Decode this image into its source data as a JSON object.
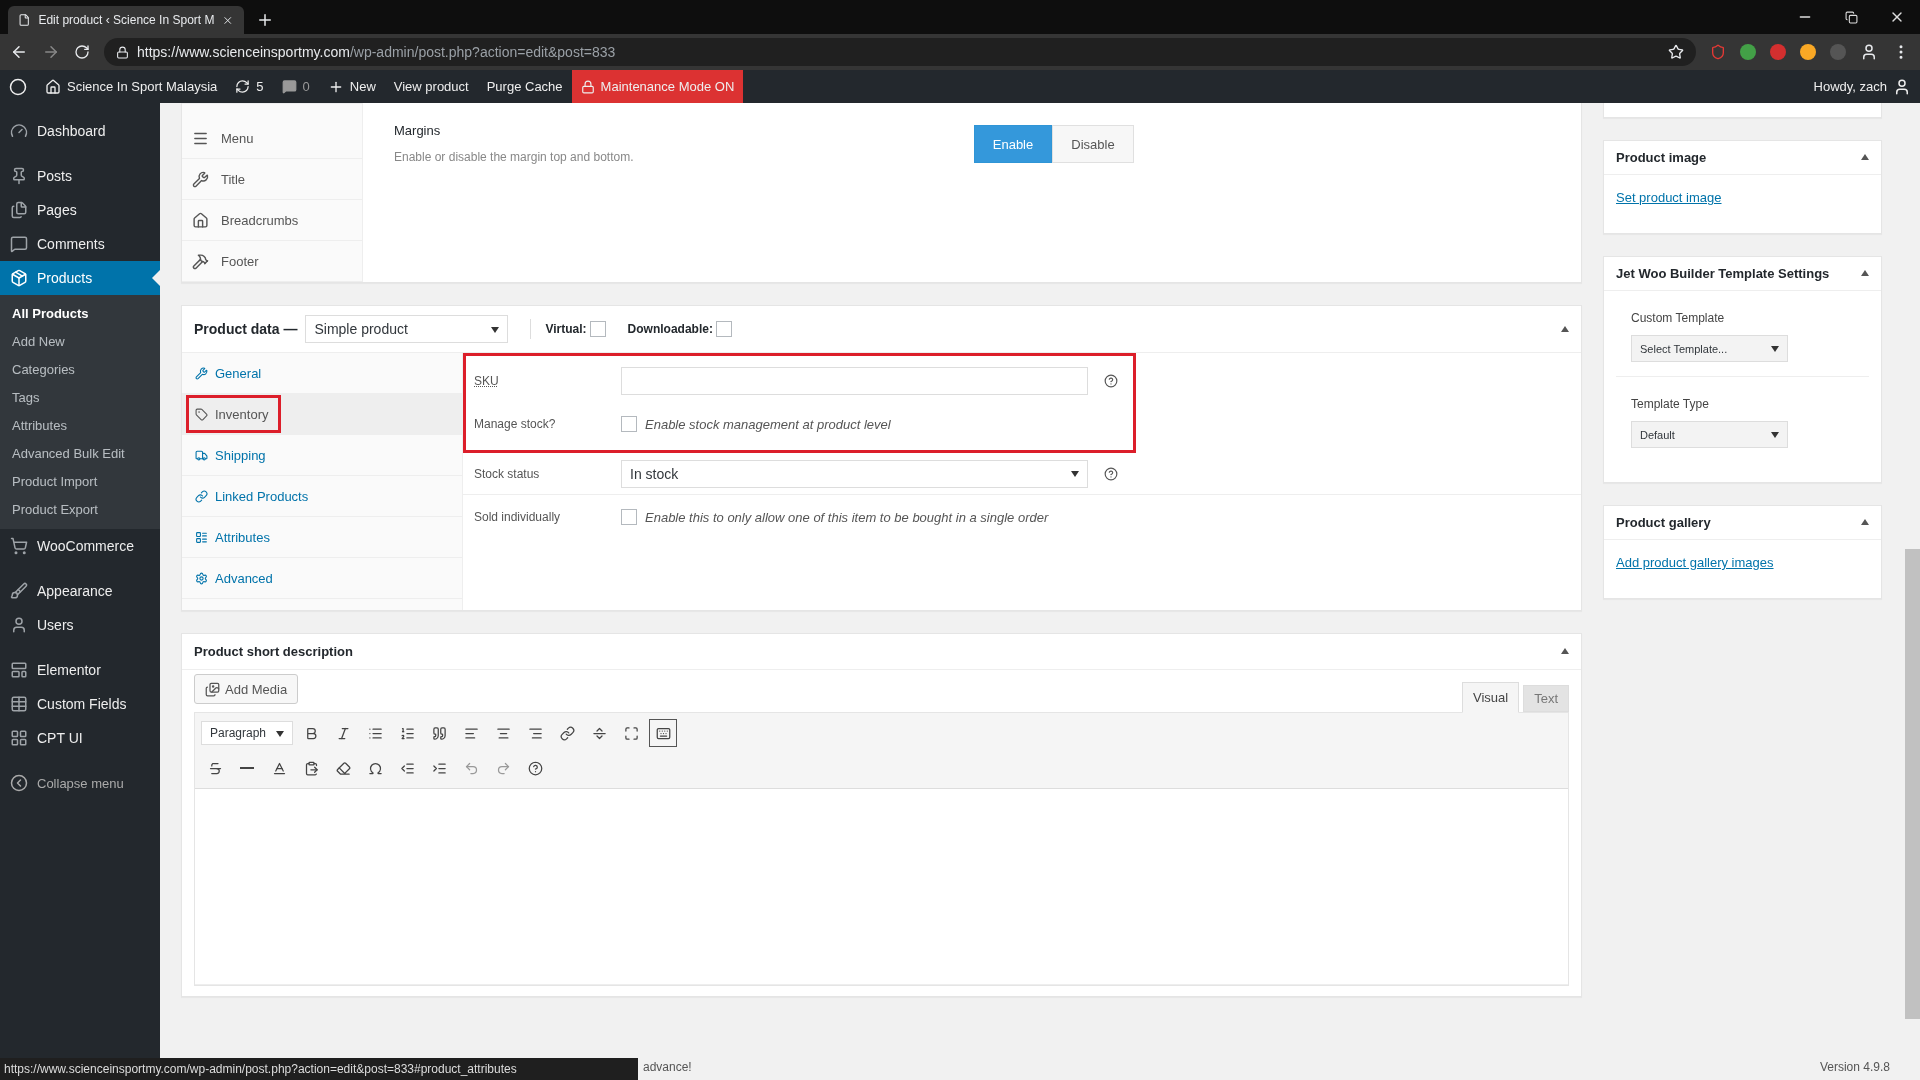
{
  "browser": {
    "tab_title": "Edit product ‹ Science In Sport M",
    "url_host": "https://www.scienceinsportmy.com",
    "url_path": "/wp-admin/post.php?action=edit&post=833"
  },
  "admin_bar": {
    "site": "Science In Sport Malaysia",
    "updates": "5",
    "comments": "0",
    "items": [
      "New",
      "View product",
      "Purge Cache"
    ],
    "maintenance": "Maintenance Mode ON",
    "howdy": "Howdy, zach"
  },
  "sidebar": {
    "groups": [
      [
        {
          "label": "Dashboard",
          "selected": false
        }
      ],
      [
        {
          "label": "Posts",
          "selected": false
        },
        {
          "label": "Pages",
          "selected": false
        },
        {
          "label": "Comments",
          "selected": false
        },
        {
          "label": "Products",
          "selected": true,
          "submenu": [
            {
              "label": "All Products",
              "selected": true
            },
            {
              "label": "Add New",
              "selected": false
            },
            {
              "label": "Categories",
              "selected": false
            },
            {
              "label": "Tags",
              "selected": false
            },
            {
              "label": "Attributes",
              "selected": false
            },
            {
              "label": "Advanced Bulk Edit",
              "selected": false
            },
            {
              "label": "Product Import",
              "selected": false
            },
            {
              "label": "Product Export",
              "selected": false
            }
          ]
        },
        {
          "label": "WooCommerce",
          "selected": false
        }
      ],
      [
        {
          "label": "Appearance",
          "selected": false
        },
        {
          "label": "Users",
          "selected": false
        }
      ],
      [
        {
          "label": "Elementor",
          "selected": false
        },
        {
          "label": "Custom Fields",
          "selected": false
        },
        {
          "label": "CPT UI",
          "selected": false
        }
      ]
    ],
    "collapse": "Collapse menu"
  },
  "elementor_box": {
    "nav": [
      {
        "label": "Menu"
      },
      {
        "label": "Title"
      },
      {
        "label": "Breadcrumbs"
      },
      {
        "label": "Footer"
      }
    ],
    "setting": {
      "title": "Margins",
      "description": "Enable or disable the margin top and bottom.",
      "options": [
        {
          "label": "Enable",
          "selected": true
        },
        {
          "label": "Disable",
          "selected": false
        }
      ]
    }
  },
  "product_data": {
    "title": "Product data —",
    "type": "Simple product",
    "flags": [
      {
        "label": "Virtual:",
        "checked": false
      },
      {
        "label": "Downloadable:",
        "checked": false
      }
    ],
    "tabs": [
      {
        "label": "General",
        "selected": false,
        "highlighted": false
      },
      {
        "label": "Inventory",
        "selected": true,
        "highlighted": true
      },
      {
        "label": "Shipping",
        "selected": false,
        "highlighted": false
      },
      {
        "label": "Linked Products",
        "selected": false,
        "highlighted": false
      },
      {
        "label": "Attributes",
        "selected": false,
        "highlighted": false
      },
      {
        "label": "Advanced",
        "selected": false,
        "highlighted": false
      }
    ],
    "highlighted_fields": [
      {
        "kind": "text",
        "label": "SKU",
        "help": true
      },
      {
        "kind": "checkbox",
        "label": "Manage stock?",
        "text": "Enable stock management at product level",
        "checked": false
      }
    ],
    "fields": [
      {
        "kind": "select",
        "label": "Stock status",
        "value": "In stock",
        "help": true
      },
      {
        "kind": "checkbox",
        "label": "Sold individually",
        "text": "Enable this to only allow one of this item to be bought in a single order",
        "checked": false
      }
    ]
  },
  "short_description": {
    "title": "Product short description",
    "add_media": "Add Media",
    "format": "Paragraph",
    "modes": [
      {
        "label": "Visual",
        "selected": true
      },
      {
        "label": "Text",
        "selected": false
      }
    ]
  },
  "right_boxes": [
    {
      "title": "Product image",
      "link": "Set product image"
    },
    {
      "title": "Jet Woo Builder Template Settings",
      "fields": [
        {
          "label": "Custom Template",
          "value": "Select Template..."
        },
        {
          "label": "Template Type",
          "value": "Default"
        }
      ]
    },
    {
      "title": "Product gallery",
      "link": "Add product gallery images"
    }
  ],
  "footer": {
    "thanks": "advance!",
    "version": "Version 4.9.8"
  },
  "status_url": "https://www.scienceinsportmy.com/wp-admin/post.php?action=edit&post=833#product_attributes"
}
